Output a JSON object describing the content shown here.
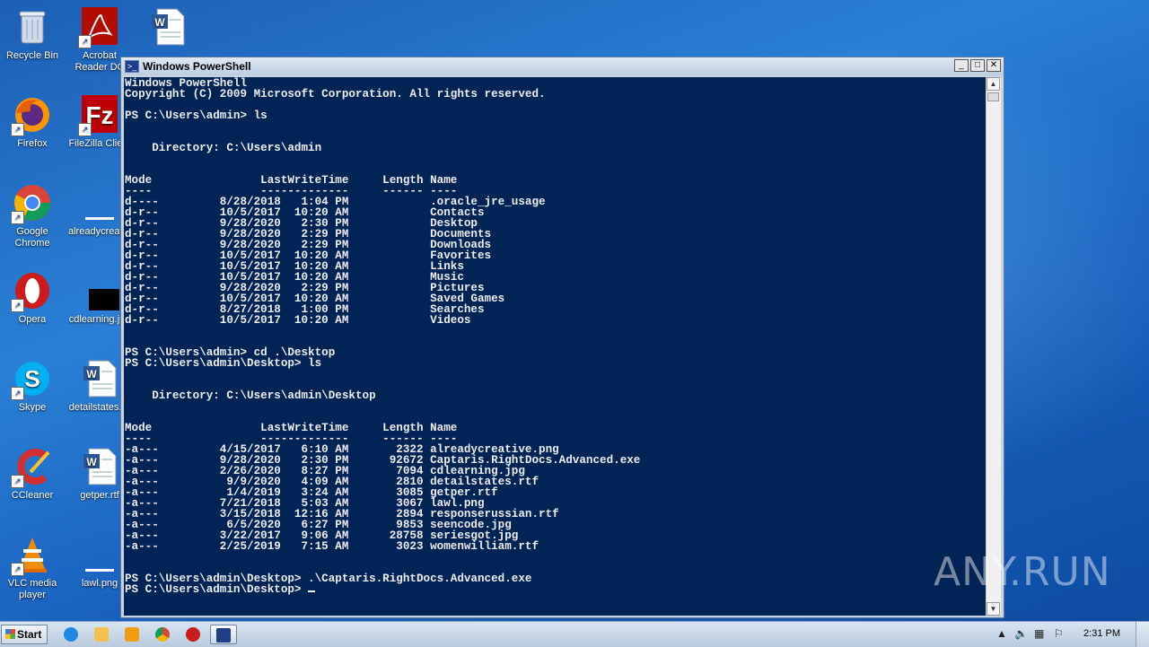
{
  "desktop": {
    "icons": [
      {
        "label": "Recycle Bin",
        "icon": "recycle-bin-icon",
        "color": "#9fb6cf"
      },
      {
        "label": "Acrobat Reader DC",
        "icon": "acrobat-icon",
        "color": "#b30b00"
      },
      {
        "label": "",
        "icon": "word-doc-icon",
        "color": "#2b5797"
      },
      {
        "label": "Firefox",
        "icon": "firefox-icon",
        "color": "#e66000"
      },
      {
        "label": "FileZilla Client",
        "icon": "filezilla-icon",
        "color": "#bf0000"
      },
      {
        "label": "Google Chrome",
        "icon": "chrome-icon",
        "color": "#4285f4"
      },
      {
        "label": "alreadycreative.png",
        "icon": "image-file-icon",
        "color": "#ffffff"
      },
      {
        "label": "Opera",
        "icon": "opera-icon",
        "color": "#cc1b1b"
      },
      {
        "label": "cdlearning.jpg",
        "icon": "image-file-icon",
        "color": "#000000"
      },
      {
        "label": "Skype",
        "icon": "skype-icon",
        "color": "#00aff0"
      },
      {
        "label": "detailstates.rtf",
        "icon": "word-doc-icon",
        "color": "#2b5797"
      },
      {
        "label": "CCleaner",
        "icon": "ccleaner-icon",
        "color": "#d32f2f"
      },
      {
        "label": "getper.rtf",
        "icon": "word-doc-icon",
        "color": "#2b5797"
      },
      {
        "label": "VLC media player",
        "icon": "vlc-icon",
        "color": "#f08c00"
      },
      {
        "label": "lawl.png",
        "icon": "image-file-icon",
        "color": "#ffffff"
      }
    ]
  },
  "window": {
    "title": "Windows PowerShell",
    "minimize": "_",
    "maximize": "□",
    "close": "✕"
  },
  "console": {
    "lines": [
      "Windows PowerShell",
      "Copyright (C) 2009 Microsoft Corporation. All rights reserved.",
      "",
      "PS C:\\Users\\admin> ls",
      "",
      "",
      "    Directory: C:\\Users\\admin",
      "",
      "",
      "Mode                LastWriteTime     Length Name",
      "----                -------------     ------ ----",
      "d----         8/28/2018   1:04 PM            .oracle_jre_usage",
      "d-r--         10/5/2017  10:20 AM            Contacts",
      "d-r--         9/28/2020   2:30 PM            Desktop",
      "d-r--         9/28/2020   2:29 PM            Documents",
      "d-r--         9/28/2020   2:29 PM            Downloads",
      "d-r--         10/5/2017  10:20 AM            Favorites",
      "d-r--         10/5/2017  10:20 AM            Links",
      "d-r--         10/5/2017  10:20 AM            Music",
      "d-r--         9/28/2020   2:29 PM            Pictures",
      "d-r--         10/5/2017  10:20 AM            Saved Games",
      "d-r--         8/27/2018   1:00 PM            Searches",
      "d-r--         10/5/2017  10:20 AM            Videos",
      "",
      "",
      "PS C:\\Users\\admin> cd .\\Desktop",
      "PS C:\\Users\\admin\\Desktop> ls",
      "",
      "",
      "    Directory: C:\\Users\\admin\\Desktop",
      "",
      "",
      "Mode                LastWriteTime     Length Name",
      "----                -------------     ------ ----",
      "-a---         4/15/2017   6:10 AM       2322 alreadycreative.png",
      "-a---         9/28/2020   2:30 PM      92672 Captaris.RightDocs.Advanced.exe",
      "-a---         2/26/2020   8:27 PM       7094 cdlearning.jpg",
      "-a---          9/9/2020   4:09 AM       2810 detailstates.rtf",
      "-a---          1/4/2019   3:24 AM       3085 getper.rtf",
      "-a---         7/21/2018   5:03 AM       3067 lawl.png",
      "-a---         3/15/2018  12:16 AM       2894 responserussian.rtf",
      "-a---          6/5/2020   6:27 PM       9853 seencode.jpg",
      "-a---         3/22/2017   9:06 AM      28758 seriesgot.jpg",
      "-a---         2/25/2019   7:15 AM       3023 womenwilliam.rtf",
      "",
      "",
      "PS C:\\Users\\admin\\Desktop> .\\Captaris.RightDocs.Advanced.exe",
      "PS C:\\Users\\admin\\Desktop> "
    ]
  },
  "watermark": "ANY.RUN",
  "taskbar": {
    "start_label": "Start",
    "clock": "2:31 PM",
    "items": [
      {
        "name": "internet-explorer-icon",
        "color": "#1e88e5"
      },
      {
        "name": "explorer-folder-icon",
        "color": "#f2c14e"
      },
      {
        "name": "media-player-icon",
        "color": "#f39c12"
      },
      {
        "name": "chrome-icon",
        "color": "#4285f4"
      },
      {
        "name": "opera-icon",
        "color": "#cc1b1b"
      },
      {
        "name": "powershell-icon",
        "color": "#1d3f8a"
      }
    ]
  }
}
